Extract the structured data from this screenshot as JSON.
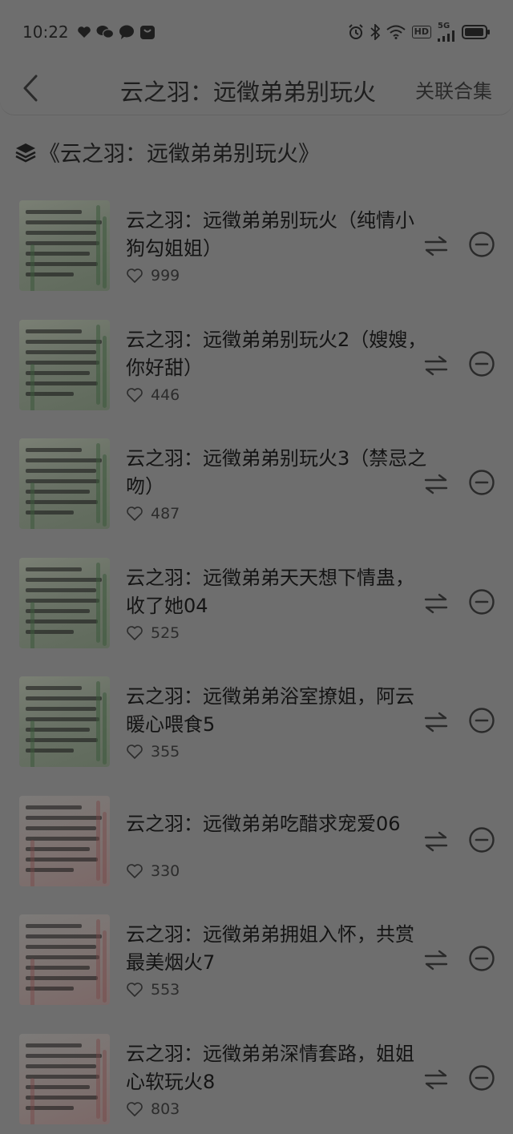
{
  "status_bar": {
    "time": "10:22",
    "hd": "HD",
    "network": "5G",
    "left_icons": [
      "heart-icon",
      "wechat-icon",
      "message-icon",
      "app-bag-icon"
    ],
    "right_icons": [
      "alarm-icon",
      "bluetooth-icon",
      "wifi-icon",
      "signal-icon",
      "battery-icon"
    ]
  },
  "header": {
    "title": "云之羽：远徵弟弟别玩火",
    "action_label": "关联合集"
  },
  "collection": {
    "title": "《云之羽：远徵弟弟别玩火》"
  },
  "colors": {
    "background": "#6e6e6e",
    "text": "#141414"
  },
  "episodes": [
    {
      "title": "云之羽：远徵弟弟别玩火（纯情小狗勾姐姐）",
      "likes": "999"
    },
    {
      "title": "云之羽：远徵弟弟别玩火2（嫂嫂，你好甜）",
      "likes": "446"
    },
    {
      "title": "云之羽：远徵弟弟别玩火3（禁忌之吻）",
      "likes": "487"
    },
    {
      "title": "云之羽：远徵弟弟天天想下情蛊，收了她04",
      "likes": "525"
    },
    {
      "title": "云之羽：远徵弟弟浴室撩姐，阿云暖心喂食5",
      "likes": "355"
    },
    {
      "title": "云之羽：远徵弟弟吃醋求宠爱06",
      "likes": "330"
    },
    {
      "title": "云之羽：远徵弟弟拥姐入怀，共赏最美烟火7",
      "likes": "553"
    },
    {
      "title": "云之羽：远徵弟弟深情套路，姐姐心软玩火8",
      "likes": "803"
    }
  ]
}
